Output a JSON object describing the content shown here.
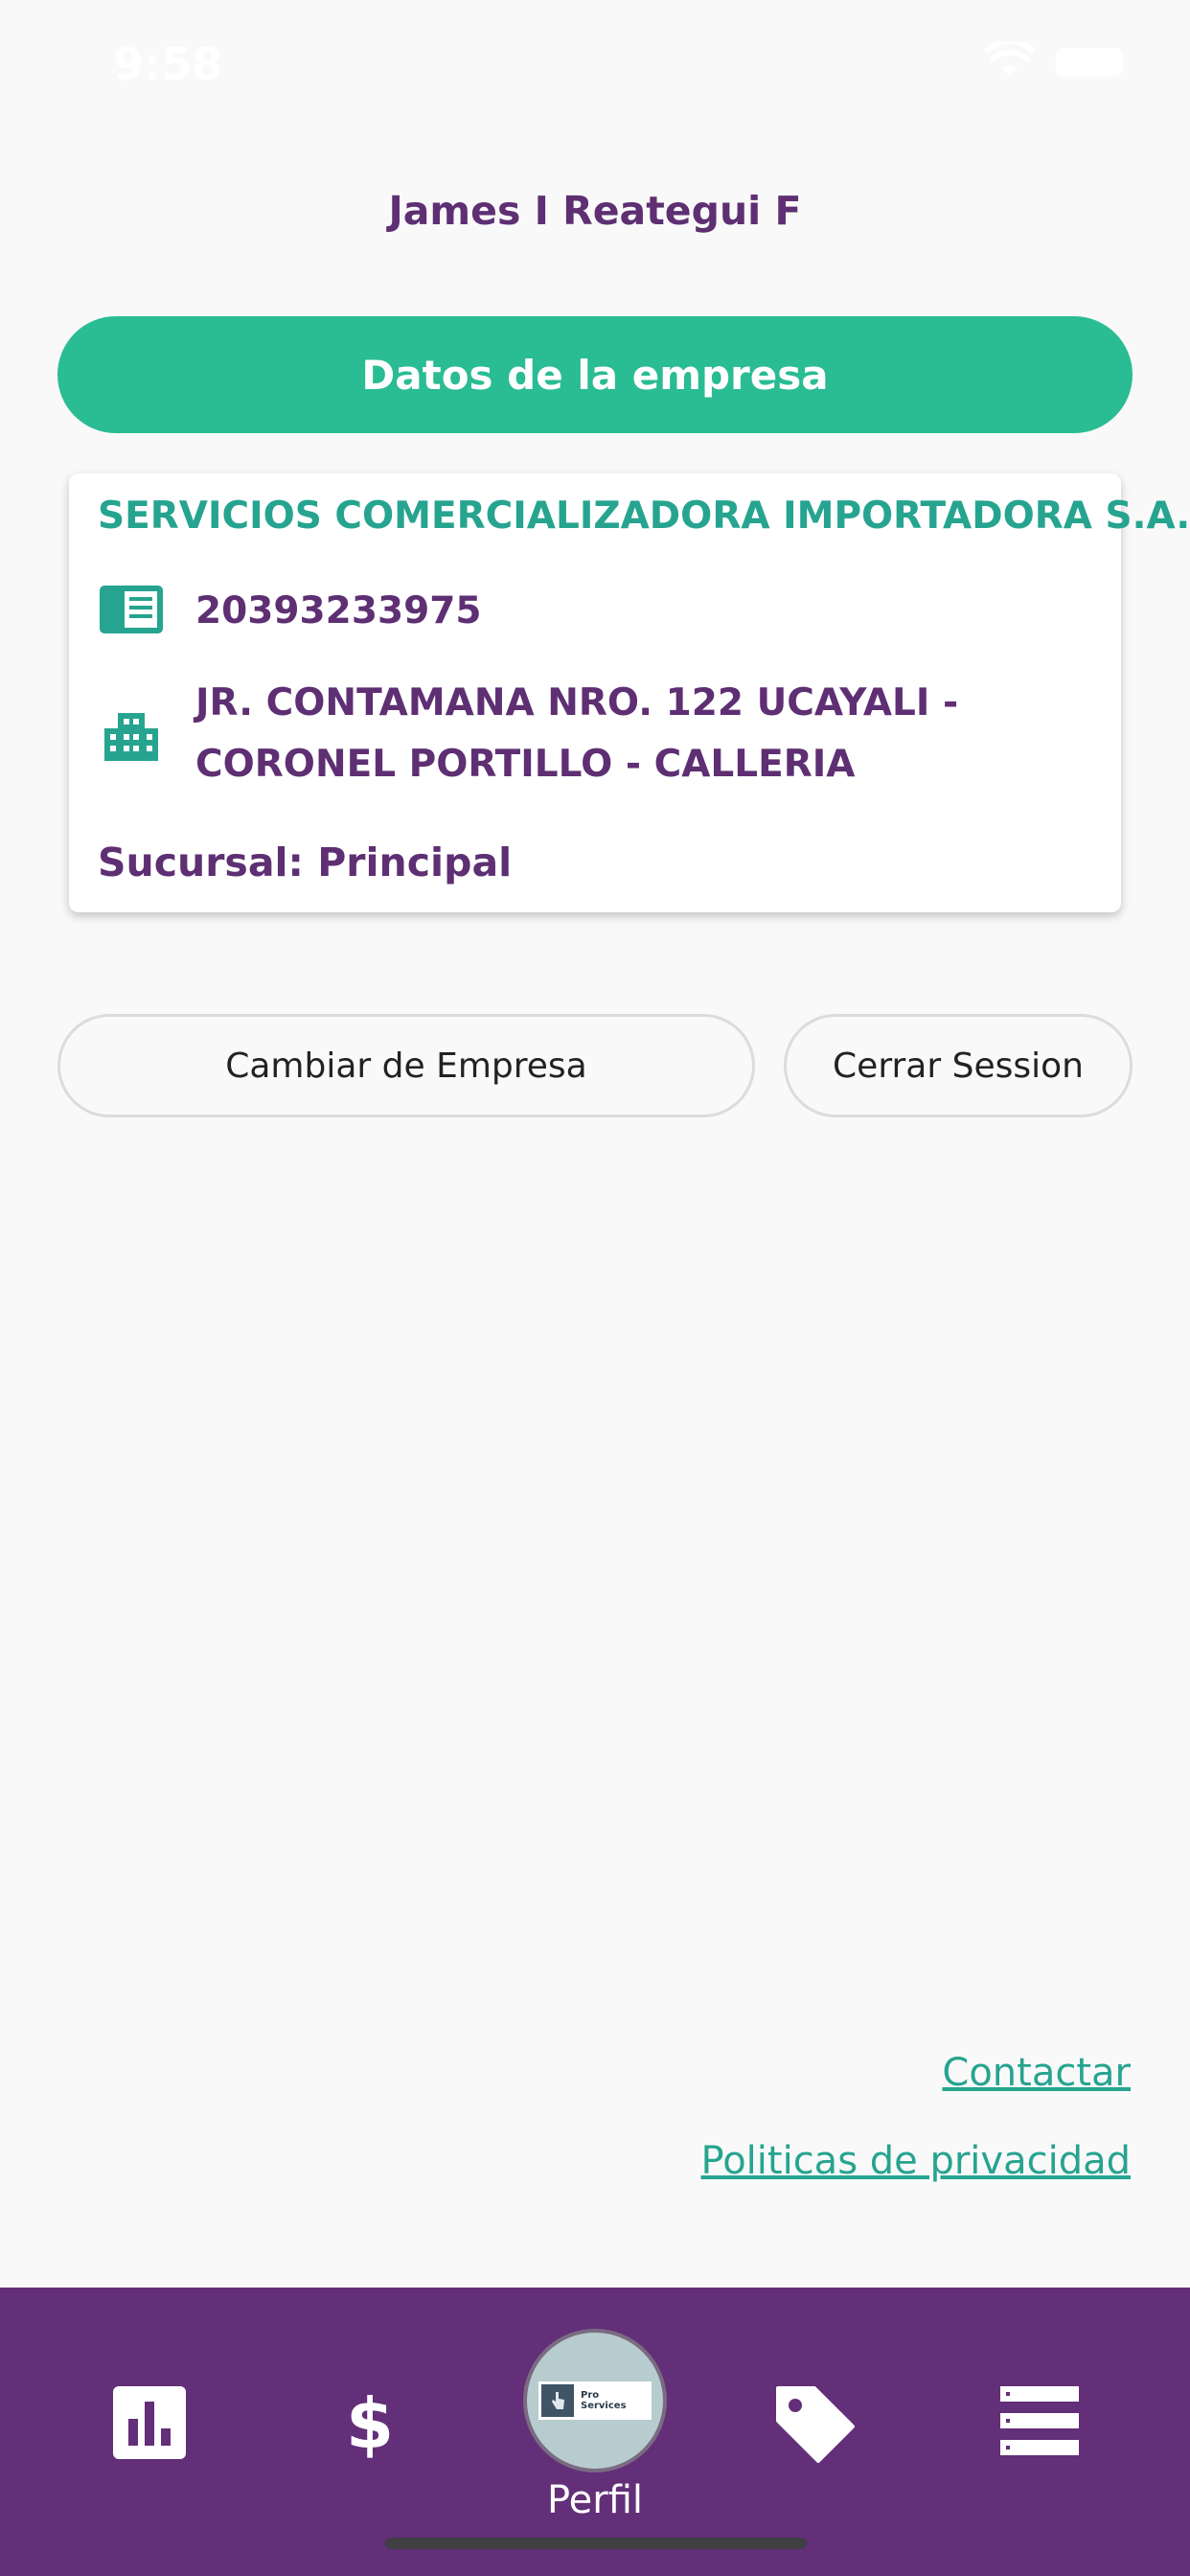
{
  "status_bar": {
    "time": "9:58"
  },
  "profile": {
    "user_name": "James I Reategui F"
  },
  "section": {
    "title": "Datos de la empresa"
  },
  "company": {
    "name": "SERVICIOS COMERCIALIZADORA IMPORTADORA S.A.",
    "ruc": "20393233975",
    "address": "JR. CONTAMANA NRO. 122 UCAYALI - CORONEL PORTILLO - CALLERIA",
    "branch": "Sucursal: Principal"
  },
  "actions": {
    "change_company": "Cambiar de Empresa",
    "logout": "Cerrar Session"
  },
  "links": {
    "contact": "Contactar",
    "privacy": "Politicas de privacidad"
  },
  "bottom_nav": {
    "items": [
      {
        "icon": "bar-chart-icon"
      },
      {
        "icon": "dollar-icon"
      },
      {
        "icon": "pro-services-logo",
        "label": "Perfil",
        "logo_text_1": "Pro",
        "logo_text_2": "Services"
      },
      {
        "icon": "tag-icon"
      },
      {
        "icon": "list-icon"
      }
    ]
  },
  "colors": {
    "purple": "#622f78",
    "green": "#2abc93",
    "teal_text": "#26a48f",
    "text_purple": "#5e2f73"
  }
}
